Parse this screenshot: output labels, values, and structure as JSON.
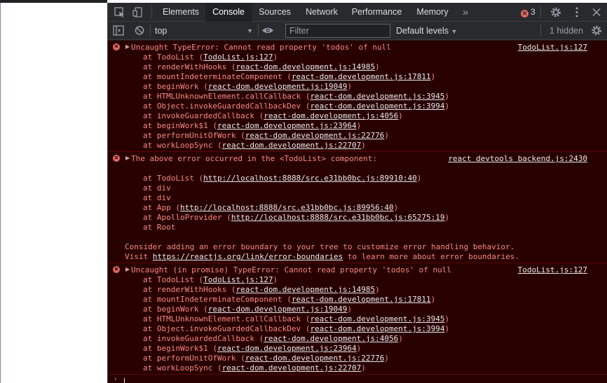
{
  "tabs": [
    {
      "label": "Elements"
    },
    {
      "label": "Console"
    },
    {
      "label": "Sources"
    },
    {
      "label": "Network"
    },
    {
      "label": "Performance"
    },
    {
      "label": "Memory"
    }
  ],
  "more_tabs_glyph": "»",
  "error_count": "3",
  "toolbar": {
    "context": "top",
    "filter_placeholder": "Filter",
    "levels": "Default levels",
    "hidden": "1 hidden"
  },
  "messages": [
    {
      "source": "TodoList.js:127",
      "head": "Uncaught TypeError: Cannot read property 'todos' of null",
      "frames": [
        [
          "TodoList",
          "TodoList.js:127"
        ],
        [
          "renderWithHooks",
          "react-dom.development.js:14985"
        ],
        [
          "mountIndeterminateComponent",
          "react-dom.development.js:17811"
        ],
        [
          "beginWork",
          "react-dom.development.js:19049"
        ],
        [
          "HTMLUnknownElement.callCallback",
          "react-dom.development.js:3945"
        ],
        [
          "Object.invokeGuardedCallbackDev",
          "react-dom.development.js:3994"
        ],
        [
          "invokeGuardedCallback",
          "react-dom.development.js:4056"
        ],
        [
          "beginWork$1",
          "react-dom.development.js:23964"
        ],
        [
          "performUnitOfWork",
          "react-dom.development.js:22776"
        ],
        [
          "workLoopSync",
          "react-dom.development.js:22707"
        ]
      ]
    },
    {
      "source": "react devtools backend.js:2430",
      "head": "The above error occurred in the <TodoList> component:",
      "frames": [
        [
          "TodoList",
          "http://localhost:8888/src.e31bb0bc.js:89910:40"
        ],
        [
          "div",
          ""
        ],
        [
          "div",
          ""
        ],
        [
          "App",
          "http://localhost:8888/src.e31bb0bc.js:89956:40"
        ],
        [
          "ApolloProvider",
          "http://localhost:8888/src.e31bb0bc.js:65275:19"
        ],
        [
          "Root",
          ""
        ]
      ],
      "note1": "Consider adding an error boundary to your tree to customize error handling behavior.",
      "note2_pre": "Visit ",
      "note2_link": "https://reactjs.org/link/error-boundaries",
      "note2_post": " to learn more about error boundaries."
    },
    {
      "source": "TodoList.js:127",
      "head": "Uncaught (in promise) TypeError: Cannot read property 'todos' of null",
      "frames": [
        [
          "TodoList",
          "TodoList.js:127"
        ],
        [
          "renderWithHooks",
          "react-dom.development.js:14985"
        ],
        [
          "mountIndeterminateComponent",
          "react-dom.development.js:17811"
        ],
        [
          "beginWork",
          "react-dom.development.js:19049"
        ],
        [
          "HTMLUnknownElement.callCallback",
          "react-dom.development.js:3945"
        ],
        [
          "Object.invokeGuardedCallbackDev",
          "react-dom.development.js:3994"
        ],
        [
          "invokeGuardedCallback",
          "react-dom.development.js:4056"
        ],
        [
          "beginWork$1",
          "react-dom.development.js:23964"
        ],
        [
          "performUnitOfWork",
          "react-dom.development.js:22776"
        ],
        [
          "workLoopSync",
          "react-dom.development.js:22707"
        ]
      ]
    }
  ],
  "frame_prefix": "at ",
  "colors": {
    "console_bg": "#290000",
    "error_text": "#f28b82",
    "link_text": "#e8eaed",
    "error_icon": "#e46962"
  }
}
